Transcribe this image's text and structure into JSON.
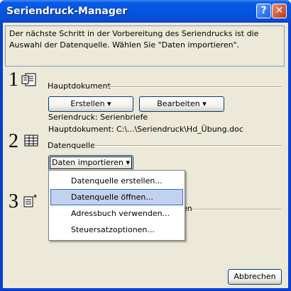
{
  "window": {
    "title": "Seriendruck-Manager",
    "help_glyph": "?",
    "close_glyph": "✕"
  },
  "info_text": "Der nächste Schritt in der Vorbereitung des Seriendrucks ist die Auswahl der Datenquelle. Wählen Sie \"Daten importieren\".",
  "steps": {
    "step1": {
      "number": "1",
      "label": "Hauptdokument",
      "create_button": "Erstellen",
      "edit_button": "Bearbeiten",
      "merge_type": "Seriendruck: Serienbriefe",
      "main_document": "Hauptdokument: C:\\...\\Seriendruck\\Hd_Übung.doc"
    },
    "step2": {
      "number": "2",
      "label": "Datenquelle",
      "import_button": "Daten importieren"
    },
    "step3": {
      "number": "3",
      "partial_text": "en"
    }
  },
  "dropdown_arrow": "▾",
  "menu": {
    "items": [
      {
        "label": "Datenquelle erstellen..."
      },
      {
        "label": "Datenquelle öffnen...",
        "highlighted": true
      },
      {
        "label": "Adressbuch verwenden..."
      },
      {
        "label": "Steuersatzoptionen..."
      }
    ]
  },
  "cancel_button": "Abbrechen"
}
